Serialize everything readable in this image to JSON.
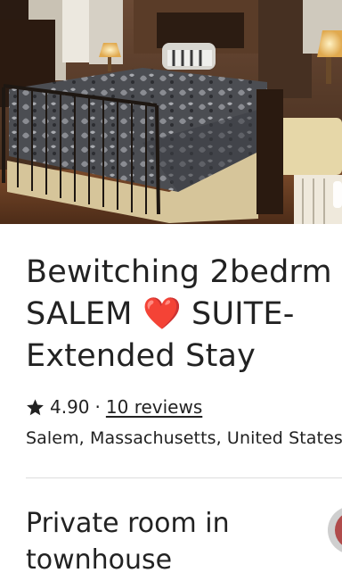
{
  "hero": {
    "photo_icon": "bedroom-photo"
  },
  "listing": {
    "title_lines": [
      "Bewitching 2bedrm",
      "SALEM ❤️ SUITE-",
      "Extended Stay"
    ],
    "rating_icon": "star-icon",
    "rating": "4.90",
    "separator": "·",
    "reviews_label": "10 reviews",
    "location": "Salem, Massachusetts, United States",
    "room_type": "Private room in townhouse"
  },
  "host": {
    "avatar_icon": "host-avatar"
  }
}
